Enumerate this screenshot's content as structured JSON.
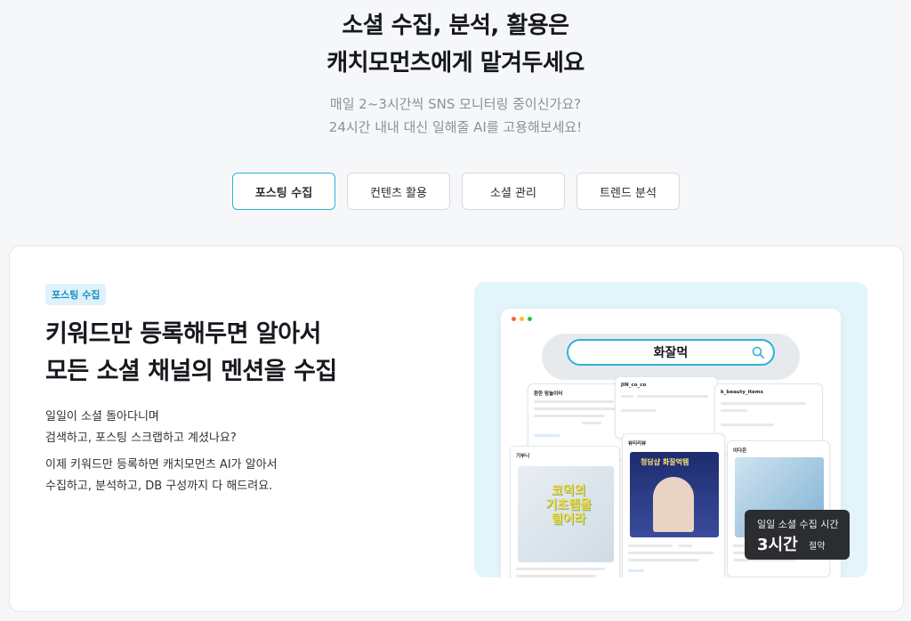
{
  "hero": {
    "title_line1": "소셜 수집, 분석, 활용은",
    "title_line2": "캐치모먼츠에게 맡겨두세요",
    "sub_line1": "매일 2~3시간씩 SNS 모니터링 중이신가요?",
    "sub_line2": "24시간 내내 대신 일해줄 AI를 고용해보세요!"
  },
  "tabs": [
    {
      "label": "포스팅 수집",
      "active": true
    },
    {
      "label": "컨텐츠 활용",
      "active": false
    },
    {
      "label": "소셜 관리",
      "active": false
    },
    {
      "label": "트렌드 분석",
      "active": false
    }
  ],
  "feature": {
    "badge": "포스팅 수집",
    "title_line1": "키워드만 등록해두면 알아서",
    "title_line2": "모든 소셜 채널의 멘션을 수집",
    "desc1_line1": "일일이 소셜 돌아다니며",
    "desc1_line2": "검색하고, 포스팅 스크랩하고 계셨나요?",
    "desc2_line1": "이제 키워드만 등록하면 캐치모먼츠 AI가 알아서",
    "desc2_line2": "수집하고, 분석하고, DB 구성까지 다 해드려요."
  },
  "visual": {
    "search_keyword": "화잘먹",
    "posts": {
      "p1_account": "환한 맘놀이터",
      "p2_account": "JIN_co_co",
      "p3_account": "k_beauty_items",
      "p4_account": "기부니",
      "p5_account": "뷰티리뷰",
      "p5_banner": "청담샵 화잘먹템",
      "p6_account": "이다은",
      "p4_overlay_line1": "코덕의",
      "p4_overlay_line2": "기초템을",
      "p4_overlay_line3": "털어라"
    },
    "stats": {
      "label": "일일 소셜 수집 시간",
      "value": "3시간",
      "suffix": "절약"
    }
  },
  "colors": {
    "accent": "#2bb3d6",
    "badge_bg": "#dff2fb",
    "visual_bg": "#e3f4fb"
  }
}
